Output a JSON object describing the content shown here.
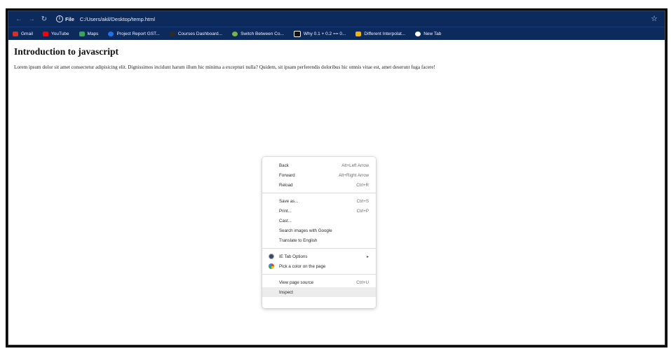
{
  "browser": {
    "site_label": "File",
    "url": "C:/Users/akil/Desktop/temp.html"
  },
  "bookmarks": [
    {
      "label": "Gmail",
      "color": "#d93025"
    },
    {
      "label": "YouTube",
      "color": "#ff0000"
    },
    {
      "label": "Maps",
      "color": "#34a853"
    },
    {
      "label": "Project Report GST...",
      "color": "#1a73e8"
    },
    {
      "label": "Courses Dashboard...",
      "color": "#2b2b2b"
    },
    {
      "label": "Switch Between Co...",
      "color": "#7cb342"
    },
    {
      "label": "Why 0.1 + 0.2 == 0...",
      "color": "#111111"
    },
    {
      "label": "Different Interpolat...",
      "color": "#f4b400"
    },
    {
      "label": "New Tab",
      "color": "#ffffff"
    }
  ],
  "page": {
    "heading": "Introduction to javascript",
    "paragraph": "Lorem ipsum dolor sit amet consectetur adipisicing elit. Dignissimos incidunt harum illum hic minima a excepturi nulla? Quidem, sit ipsam perferendis doloribus hic omnis vitae est, amet deserunt fuga facere!"
  },
  "context_menu": {
    "back": {
      "label": "Back",
      "shortcut": "Alt+Left Arrow"
    },
    "forward": {
      "label": "Forward",
      "shortcut": "Alt+Right Arrow"
    },
    "reload": {
      "label": "Reload",
      "shortcut": "Ctrl+R"
    },
    "save_as": {
      "label": "Save as...",
      "shortcut": "Ctrl+S"
    },
    "print": {
      "label": "Print...",
      "shortcut": "Ctrl+P"
    },
    "cast": {
      "label": "Cast..."
    },
    "search_images": {
      "label": "Search images with Google"
    },
    "translate": {
      "label": "Translate to English"
    },
    "ie_tab": {
      "label": "IE Tab Options"
    },
    "pick_color": {
      "label": "Pick a color on the page"
    },
    "view_source": {
      "label": "View page source",
      "shortcut": "Ctrl+U"
    },
    "inspect": {
      "label": "Inspect"
    }
  }
}
